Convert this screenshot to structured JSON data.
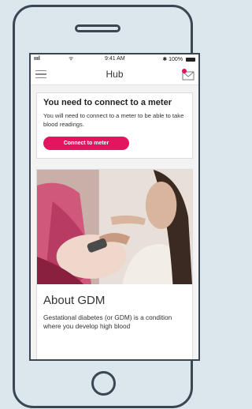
{
  "status_bar": {
    "signal": "ıııl",
    "wifi": "ᯤ",
    "time": "9:41 AM",
    "bluetooth": "✱",
    "battery": "100%"
  },
  "header": {
    "title": "Hub",
    "menu_icon": "hamburger-icon",
    "mail_icon": "mail-notification-icon"
  },
  "meter_card": {
    "heading": "You need to connect to a meter",
    "body": "You will need to connect to a meter to be able to take blood readings.",
    "button_label": "Connect to meter"
  },
  "gdm_card": {
    "heading": "About GDM",
    "body": "Gestational diabetes (or GDM) is a condition where you develop high blood"
  },
  "colors": {
    "accent": "#e3155f",
    "background": "#dbe6ed",
    "frame": "#3a4752"
  }
}
